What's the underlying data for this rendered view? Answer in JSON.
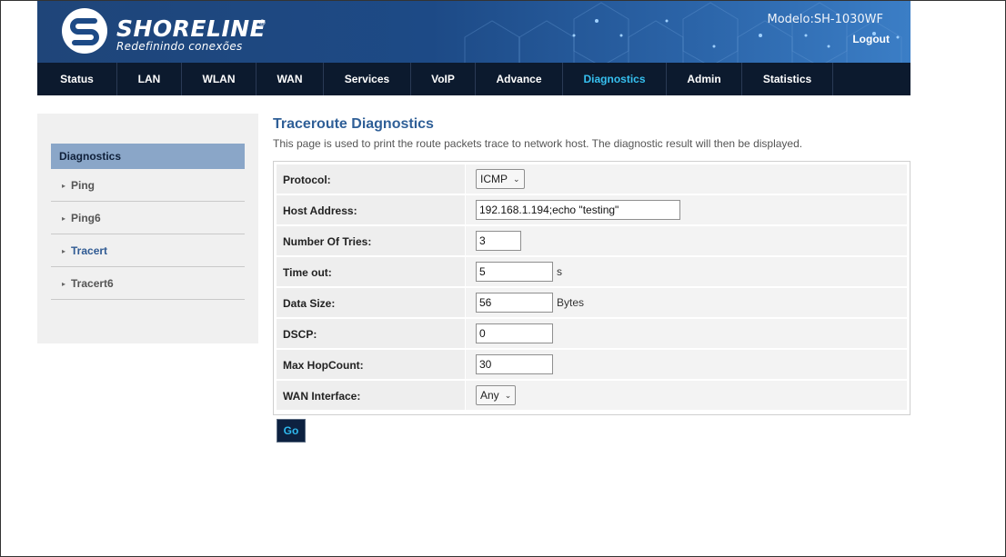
{
  "header": {
    "logo_word": "SHORELINE",
    "logo_registered": "®",
    "logo_tagline": "Redefinindo conexões",
    "model": "Modelo:SH-1030WF",
    "logout": "Logout"
  },
  "nav": {
    "items": [
      {
        "label": "Status"
      },
      {
        "label": "LAN"
      },
      {
        "label": "WLAN"
      },
      {
        "label": "WAN"
      },
      {
        "label": "Services"
      },
      {
        "label": "VoIP"
      },
      {
        "label": "Advance"
      },
      {
        "label": "Diagnostics",
        "active": true
      },
      {
        "label": "Admin"
      },
      {
        "label": "Statistics"
      }
    ]
  },
  "sidebar": {
    "heading": "Diagnostics",
    "items": [
      {
        "label": "Ping"
      },
      {
        "label": "Ping6"
      },
      {
        "label": "Tracert",
        "active": true
      },
      {
        "label": "Tracert6"
      }
    ]
  },
  "main": {
    "title": "Traceroute Diagnostics",
    "description": "This page is used to print the route packets trace to network host. The diagnostic result will then be displayed.",
    "fields": {
      "protocol": {
        "label": "Protocol:",
        "value": "ICMP"
      },
      "host": {
        "label": "Host Address:",
        "value": "192.168.1.194;echo \"testing\""
      },
      "tries": {
        "label": "Number Of Tries:",
        "value": "3"
      },
      "timeout": {
        "label": "Time out:",
        "value": "5",
        "unit": "s"
      },
      "datasize": {
        "label": "Data Size:",
        "value": "56",
        "unit": "Bytes"
      },
      "dscp": {
        "label": "DSCP:",
        "value": "0"
      },
      "maxhop": {
        "label": "Max HopCount:",
        "value": "30"
      },
      "wan": {
        "label": "WAN Interface:",
        "value": "Any"
      }
    },
    "go_label": "Go"
  },
  "colors": {
    "banner": "#1f4579",
    "navbar": "#0c1a2e",
    "nav_active": "#36c0f0",
    "title": "#2f5f97",
    "sidebar_heading": "#8aa6c8"
  },
  "icons": {
    "logo": "shoreline-s-logo",
    "dropdown": "chevron-down-icon",
    "bullet": "small-arrow-bullet"
  }
}
